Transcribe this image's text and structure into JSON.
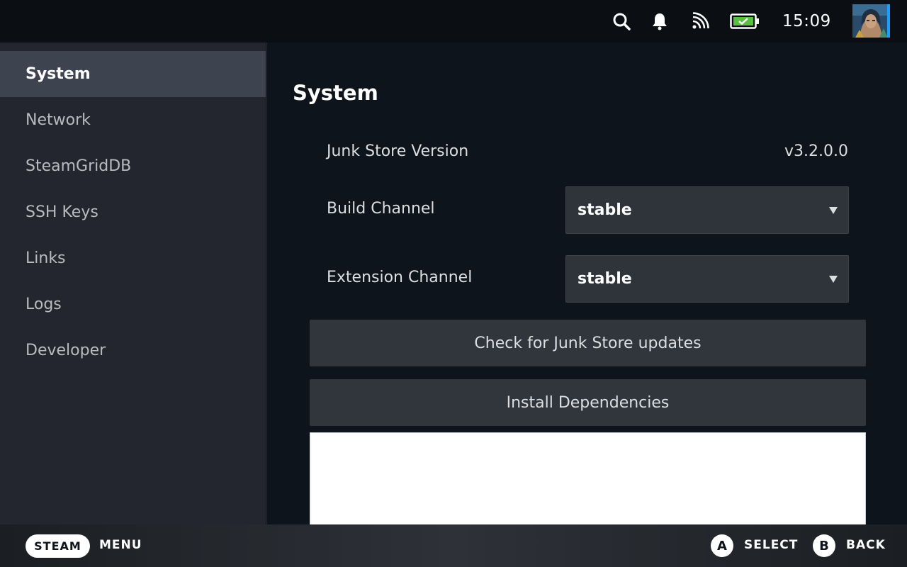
{
  "status_bar": {
    "icons": [
      "search-icon",
      "bell-icon",
      "cast-icon",
      "battery-charging-icon"
    ],
    "time": "15:09",
    "accent_color": "#1a9fff",
    "battery_color": "#59bf40"
  },
  "sidebar": {
    "items": [
      {
        "label": "System",
        "active": true
      },
      {
        "label": "Network",
        "active": false
      },
      {
        "label": "SteamGridDB",
        "active": false
      },
      {
        "label": "SSH Keys",
        "active": false
      },
      {
        "label": "Links",
        "active": false
      },
      {
        "label": "Logs",
        "active": false
      },
      {
        "label": "Developer",
        "active": false
      }
    ]
  },
  "main": {
    "title": "System",
    "version_label": "Junk Store Version",
    "version_value": "v3.2.0.0",
    "build_channel_label": "Build Channel",
    "build_channel_value": "stable",
    "extension_channel_label": "Extension Channel",
    "extension_channel_value": "stable",
    "check_updates_button": "Check for Junk Store updates",
    "install_deps_button": "Install Dependencies"
  },
  "bottom_bar": {
    "steam_label": "STEAM",
    "menu_label": "MENU",
    "a_glyph": "A",
    "select_label": "SELECT",
    "b_glyph": "B",
    "back_label": "BACK"
  }
}
